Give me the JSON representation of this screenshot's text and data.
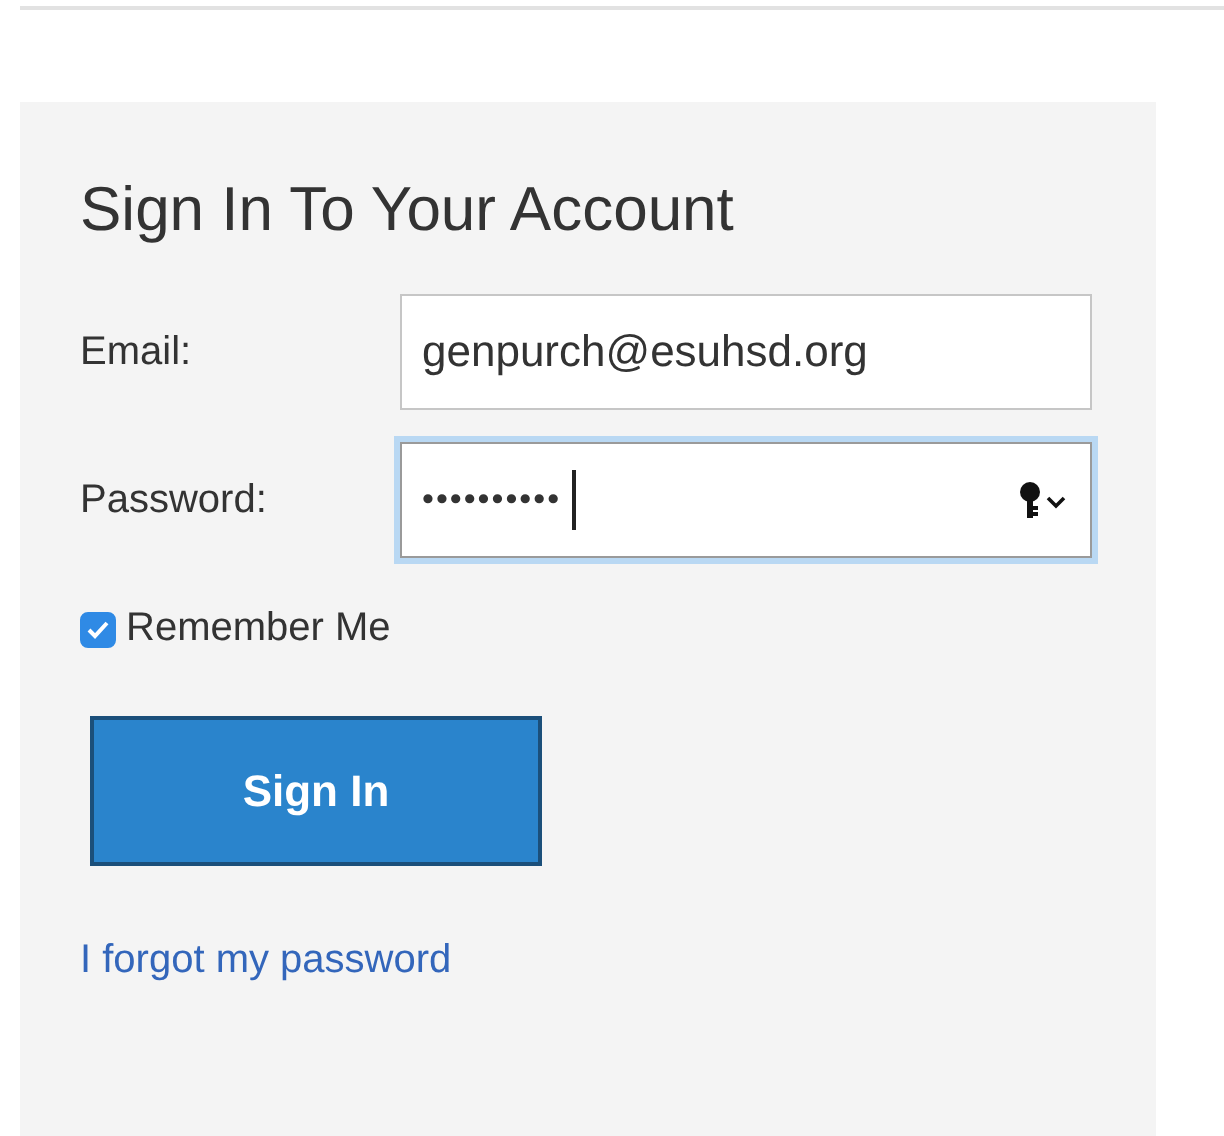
{
  "title": "Sign In To Your Account",
  "fields": [
    {
      "label": "Email:",
      "value": "genpurch@esuhsd.org",
      "kind": "text",
      "focused": false
    },
    {
      "label": "Password:",
      "value": "••••••••••",
      "kind": "password",
      "focused": true
    }
  ],
  "remember": {
    "label": "Remember Me",
    "checked": true
  },
  "submit": "Sign In",
  "forgot_link": "I forgot my password"
}
